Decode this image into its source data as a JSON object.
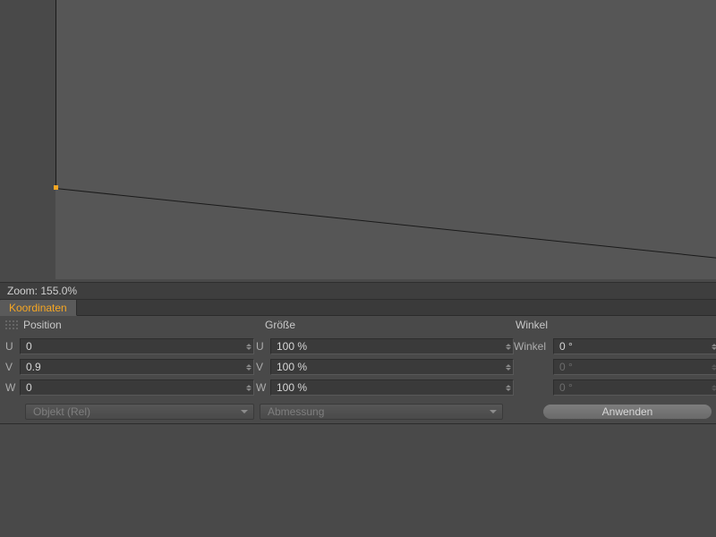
{
  "zoom": {
    "label": "Zoom: 155.0%"
  },
  "tabs": {
    "koordinaten": "Koordinaten"
  },
  "headers": {
    "position": "Position",
    "groesse": "Größe",
    "winkel": "Winkel"
  },
  "position": {
    "u": {
      "label": "U",
      "value": "0"
    },
    "v": {
      "label": "V",
      "value": "0.9"
    },
    "w": {
      "label": "W",
      "value": "0"
    }
  },
  "size": {
    "u": {
      "label": "U",
      "value": "100 %"
    },
    "v": {
      "label": "V",
      "value": "100 %"
    },
    "w": {
      "label": "W",
      "value": "100 %"
    }
  },
  "angle": {
    "label": "Winkel",
    "a": {
      "value": "0 °"
    },
    "b": {
      "value": "0 °"
    },
    "c": {
      "value": "0 °"
    }
  },
  "dropdowns": {
    "mode": "Objekt (Rel)",
    "measure": "Abmessung"
  },
  "apply": {
    "label": "Anwenden"
  }
}
